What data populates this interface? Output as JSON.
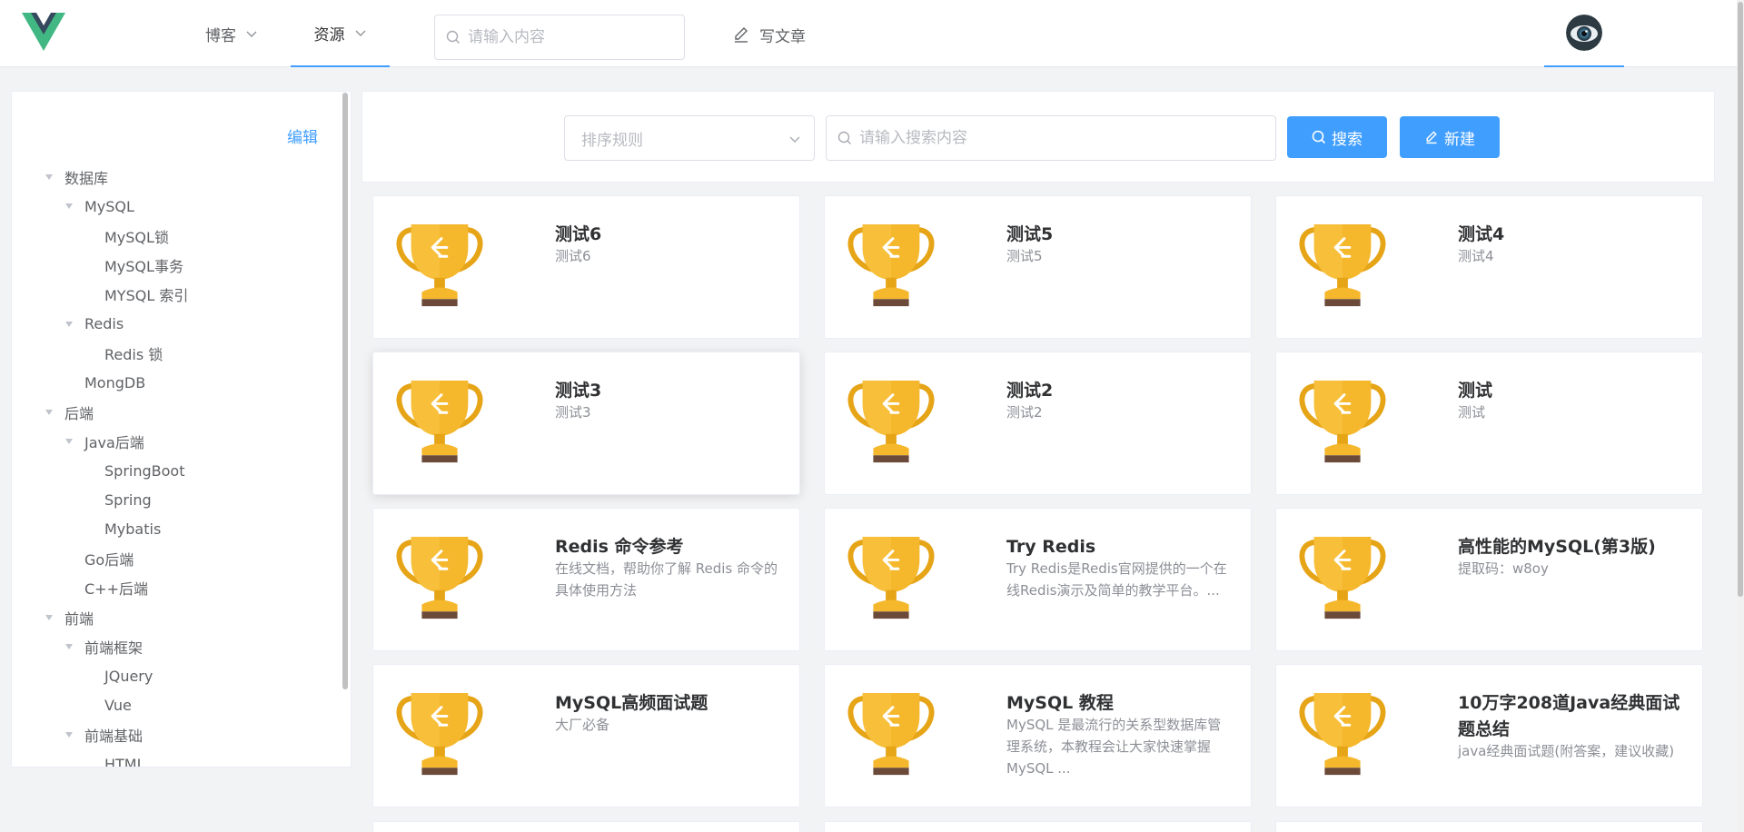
{
  "header": {
    "nav": [
      {
        "label": "博客"
      },
      {
        "label": "资源"
      }
    ],
    "search_placeholder": "请输入内容",
    "write_label": "写文章"
  },
  "sidebar": {
    "edit_label": "编辑",
    "tree": [
      {
        "label": "数据库",
        "level": 0,
        "expanded": true
      },
      {
        "label": "MySQL",
        "level": 1,
        "expanded": true
      },
      {
        "label": "MySQL锁",
        "level": 2
      },
      {
        "label": "MySQL事务",
        "level": 2
      },
      {
        "label": "MYSQL 索引",
        "level": 2
      },
      {
        "label": "Redis",
        "level": 1,
        "expanded": true
      },
      {
        "label": "Redis 锁",
        "level": 2
      },
      {
        "label": "MongDB",
        "level": 1
      },
      {
        "label": "后端",
        "level": 0,
        "expanded": true
      },
      {
        "label": "Java后端",
        "level": 1,
        "expanded": true
      },
      {
        "label": "SpringBoot",
        "level": 2
      },
      {
        "label": "Spring",
        "level": 2
      },
      {
        "label": "Mybatis",
        "level": 2
      },
      {
        "label": "Go后端",
        "level": 1
      },
      {
        "label": "C++后端",
        "level": 1
      },
      {
        "label": "前端",
        "level": 0,
        "expanded": true
      },
      {
        "label": "前端框架",
        "level": 1,
        "expanded": true
      },
      {
        "label": "JQuery",
        "level": 2
      },
      {
        "label": "Vue",
        "level": 2
      },
      {
        "label": "前端基础",
        "level": 1,
        "expanded": true
      },
      {
        "label": "HTML",
        "level": 2
      }
    ]
  },
  "toolbar": {
    "sort_placeholder": "排序规则",
    "search_placeholder": "请输入搜索内容",
    "search_label": "搜索",
    "new_label": "新建"
  },
  "cards": [
    {
      "title": "测试6",
      "desc": "测试6"
    },
    {
      "title": "测试5",
      "desc": "测试5"
    },
    {
      "title": "测试4",
      "desc": "测试4"
    },
    {
      "title": "测试3",
      "desc": "测试3"
    },
    {
      "title": "测试2",
      "desc": "测试2"
    },
    {
      "title": "测试",
      "desc": "测试"
    },
    {
      "title": "Redis 命令参考",
      "desc": "在线文档，帮助你了解 Redis 命令的具体使用方法"
    },
    {
      "title": "Try Redis",
      "desc": "Try Redis是Redis官网提供的一个在线Redis演示及简单的教学平台。..."
    },
    {
      "title": "高性能的MySQL(第3版)",
      "desc": "提取码：w8oy"
    },
    {
      "title": "MySQL高频面试题",
      "desc": "大厂必备"
    },
    {
      "title": "MySQL 教程",
      "desc": "MySQL 是最流行的关系型数据库管理系统，本教程会让大家快速掌握 MySQL ..."
    },
    {
      "title": "10万字208道Java经典面试题总结",
      "desc": "java经典面试题(附答案，建议收藏)"
    }
  ],
  "colors": {
    "accent": "#409eff",
    "trophy": "#f5b72c",
    "trophy_base": "#6b4a3a"
  }
}
